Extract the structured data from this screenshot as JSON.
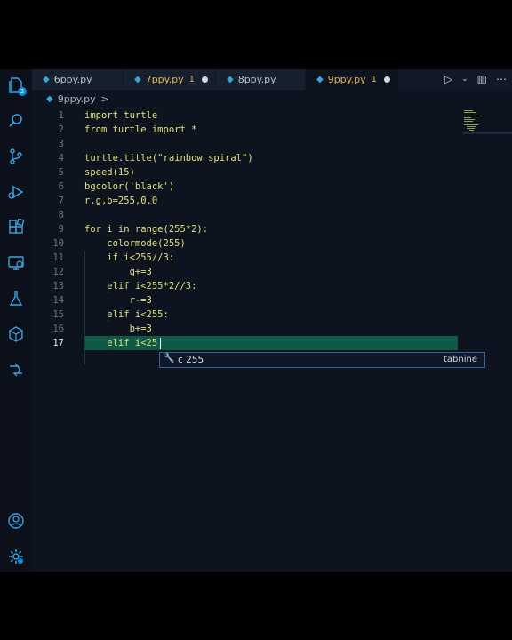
{
  "tabs": [
    {
      "name": "6ppy.py",
      "modified": false,
      "problems": ""
    },
    {
      "name": "7ppy.py",
      "modified": true,
      "problems": "1"
    },
    {
      "name": "8ppy.py",
      "modified": false,
      "problems": ""
    },
    {
      "name": "9ppy.py",
      "modified": true,
      "problems": "1",
      "active": true
    }
  ],
  "breadcrumb": {
    "file": "9ppy.py",
    "sep": ">"
  },
  "activity": {
    "explorer_badge": "2"
  },
  "lines": [
    {
      "n": "1",
      "text": "import turtle"
    },
    {
      "n": "2",
      "text": "from turtle import *"
    },
    {
      "n": "3",
      "text": ""
    },
    {
      "n": "4",
      "text": "turtle.title(\"rainbow spiral\")"
    },
    {
      "n": "5",
      "text": "speed(15)"
    },
    {
      "n": "6",
      "text": "bgcolor('black')"
    },
    {
      "n": "7",
      "text": "r,g,b=255,0,0"
    },
    {
      "n": "8",
      "text": ""
    },
    {
      "n": "9",
      "text": "for i in range(255*2):"
    },
    {
      "n": "10",
      "text": "    colormode(255)"
    },
    {
      "n": "11",
      "text": "    if i<255//3:"
    },
    {
      "n": "12",
      "text": "        g+=3"
    },
    {
      "n": "13",
      "text": "    elif i<255*2//3:"
    },
    {
      "n": "14",
      "text": "        r-=3"
    },
    {
      "n": "15",
      "text": "    elif i<255:"
    },
    {
      "n": "16",
      "text": "        b+=3"
    },
    {
      "n": "17",
      "text": "    elif i<25"
    }
  ],
  "suggestion": {
    "text": "255",
    "kind": "c",
    "source": "tabnine"
  },
  "colors": {
    "accent": "#0a8dd6",
    "code": "#e2e17a",
    "highlight": "#0f5a46"
  }
}
